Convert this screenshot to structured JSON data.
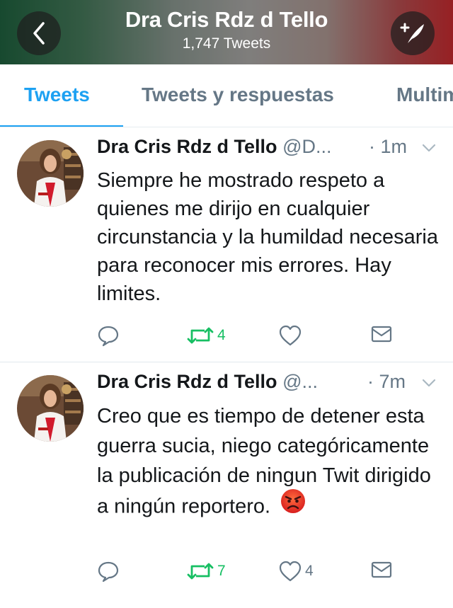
{
  "header": {
    "title": "Dra Cris Rdz d Tello",
    "tweet_count": "1,747 Tweets",
    "back_icon": "chevron-left-icon",
    "compose_icon": "compose-feather-icon"
  },
  "tabs": [
    {
      "label": "Tweets",
      "active": true
    },
    {
      "label": "Tweets y respuestas",
      "active": false
    },
    {
      "label": "Multim",
      "active": false
    }
  ],
  "colors": {
    "accent": "#1da1f2",
    "retweet_green": "#17bf63",
    "muted": "#657786"
  },
  "tweets": [
    {
      "name": "Dra Cris Rdz d Tello",
      "handle": "@D...",
      "time": "· 1m",
      "text": "Siempre he mostrado respeto a quienes me dirijo en cualquier circunstancia y la humildad necesaria para reconocer mis errores. Hay limites.",
      "emoji": "",
      "replies": "",
      "retweets": "4",
      "likes": ""
    },
    {
      "name": "Dra Cris Rdz d Tello",
      "handle": "@...",
      "time": "· 7m",
      "text": "Creo que es tiempo de detener esta guerra sucia, niego categóricamente la publicación de ningun Twit dirigido a ningún  reportero.",
      "emoji": "😡",
      "replies": "",
      "retweets": "7",
      "likes": "4"
    }
  ]
}
